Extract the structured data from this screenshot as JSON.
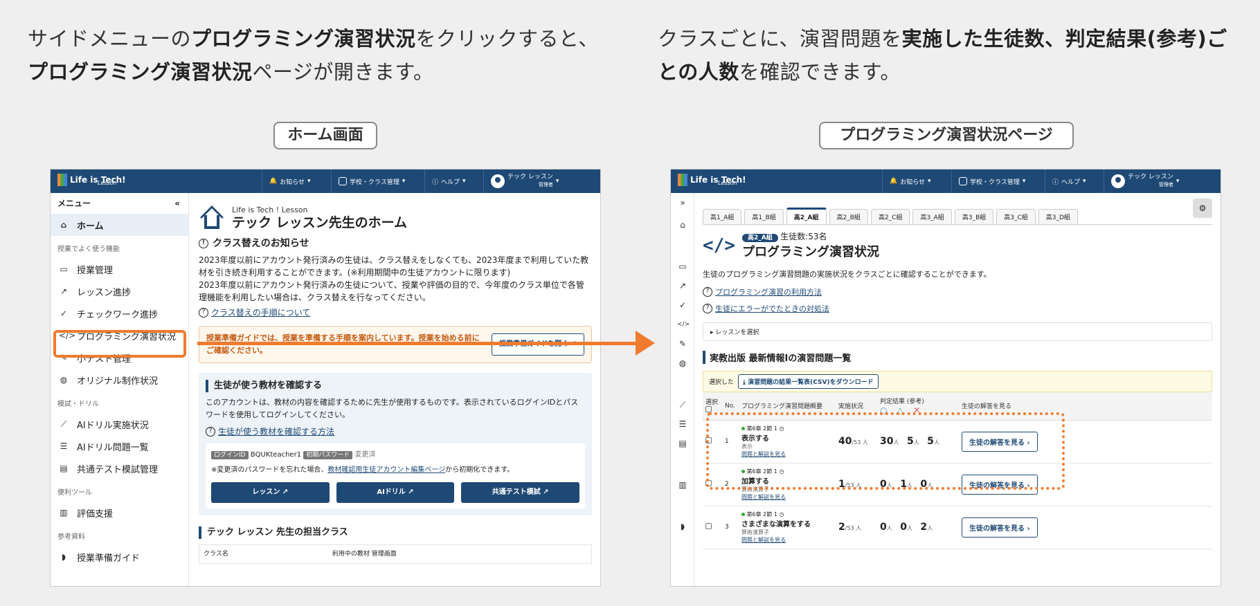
{
  "captions": {
    "left": {
      "p1": "サイドメニューの",
      "b1": "プログラミング演習状況",
      "p2": "をクリックすると、",
      "b2": "プログラミング演習状況",
      "p3": "ページが開きます。"
    },
    "right": {
      "p1": "クラスごとに、演習問題を",
      "b1": "実施した生徒数、判定結果(参考)ごとの人数",
      "p2": "を確認できます。"
    }
  },
  "pills": {
    "left": "ホーム画面",
    "right": "プログラミング演習状況ページ"
  },
  "colors": {
    "brand": "#1f4975",
    "accent": "#f07b2e"
  },
  "topbar": {
    "logo": "Life is Tech!",
    "logo_sub": "Lesson",
    "notice": "お知らせ",
    "school": "学校・クラス管理",
    "help": "ヘルプ",
    "user_name": "テック レッスン",
    "user_role": "管理者"
  },
  "sidebar": {
    "title": "メニュー",
    "home": "ホーム",
    "group1": "授業でよく使う機能",
    "items1": [
      "授業管理",
      "レッスン進捗",
      "チェックワーク進捗",
      "プログラミング演習状況",
      "小テスト管理",
      "オリジナル制作状況"
    ],
    "group2": "模試・ドリル",
    "items2": [
      "AIドリル実施状況",
      "AIドリル問題一覧",
      "共通テスト模試管理"
    ],
    "group3": "便利ツール",
    "items3": [
      "評価支援"
    ],
    "group4": "参考資料",
    "items4": [
      "授業準備ガイド"
    ]
  },
  "home": {
    "sub": "Life is Tech ! Lesson",
    "title": "テック レッスン先生のホーム",
    "notice_title": "クラス替えのお知らせ",
    "notice_p1": "2023年度以前にアカウント発行済みの生徒は、クラス替えをしなくても、2023年度まで利用していた教材を引き続き利用することができます。(※利用期間中の生徒アカウントに限ります)",
    "notice_p2": "2023年度以前にアカウント発行済みの生徒について、授業や評価の目的で、今年度のクラス単位で各管理機能を利用したい場合は、クラス替えを行なってください。",
    "notice_link": "クラス替えの手順について",
    "guide_text": "授業準備ガイドでは、授業を準備する手順を案内しています。授業を始める前にご確認ください。",
    "guide_btn": "授業準備ガイドを開く",
    "panel_title": "生徒が使う教材を確認する",
    "panel_text": "このアカウントは、教材の内容を確認するために先生が使用するものです。表示されているログインIDとパスワードを使用してログインしてください。",
    "panel_link": "生徒が使う教材を確認する方法",
    "login_id_label": "ログインID",
    "login_id": "BQUKteacher1",
    "pw_label": "初期パスワード",
    "pw_value": "変更済",
    "pw_note1": "※変更済のパスワードを忘れた場合、",
    "pw_note_link": "教材確認用生徒アカウント編集ページ",
    "pw_note2": "から初期化できます。",
    "btn_lesson": "レッスン",
    "btn_ai": "AIドリル",
    "btn_test": "共通テスト模試",
    "classes_title": "テック レッスン 先生の担当クラス",
    "table_h1": "クラス名",
    "table_h2": "利用中の教材 管理画面"
  },
  "practice": {
    "tabs": [
      "高1_A組",
      "高1_B組",
      "高2_A組",
      "高2_B組",
      "高2_C組",
      "高3_A組",
      "高3_B組",
      "高3_C組",
      "高3_D組"
    ],
    "active_tab": 2,
    "class_badge": "高2_A組",
    "students": "生徒数:53名",
    "title": "プログラミング演習状況",
    "desc": "生徒のプログラミング演習問題の実施状況をクラスごとに確認することができます。",
    "link1": "プログラミング演習の利用方法",
    "link2": "生徒にエラーがでたときの対処法",
    "lesson_select": "レッスンを選択",
    "section_title": "実教出版 最新情報Iの演習問題一覧",
    "csv_label": "選択した",
    "csv_btn": "演習問題の結果一覧表(CSV)をダウンロード",
    "headers": {
      "select": "選択",
      "no": "No.",
      "summary": "プログラミング演習問題概要",
      "status": "実施状況",
      "result": "判定結果 (参考)",
      "answers": "生徒の解答を見る"
    },
    "rows": [
      {
        "no": "1",
        "chapter": "第6章 2節 1",
        "title": "表示する",
        "sub": "表示",
        "link": "問題と解説を見る",
        "done": "40",
        "total": "/53 人",
        "ok": "30",
        "mid": "5",
        "ng": "5",
        "btn": "生徒の解答を見る"
      },
      {
        "no": "2",
        "chapter": "第6章 2節 1",
        "title": "加算する",
        "sub": "算術演算子",
        "link": "問題と解説を見る",
        "done": "1",
        "total": "/53 人",
        "ok": "0",
        "mid": "1",
        "ng": "0",
        "btn": "生徒の解答を見る"
      },
      {
        "no": "3",
        "chapter": "第6章 2節 1",
        "title": "さまざまな演算をする",
        "sub": "算術演算子",
        "link": "問題と解説を見る",
        "done": "2",
        "total": "/53 人",
        "ok": "0",
        "mid": "0",
        "ng": "2",
        "btn": "生徒の解答を見る"
      }
    ],
    "unit_person": "人"
  }
}
